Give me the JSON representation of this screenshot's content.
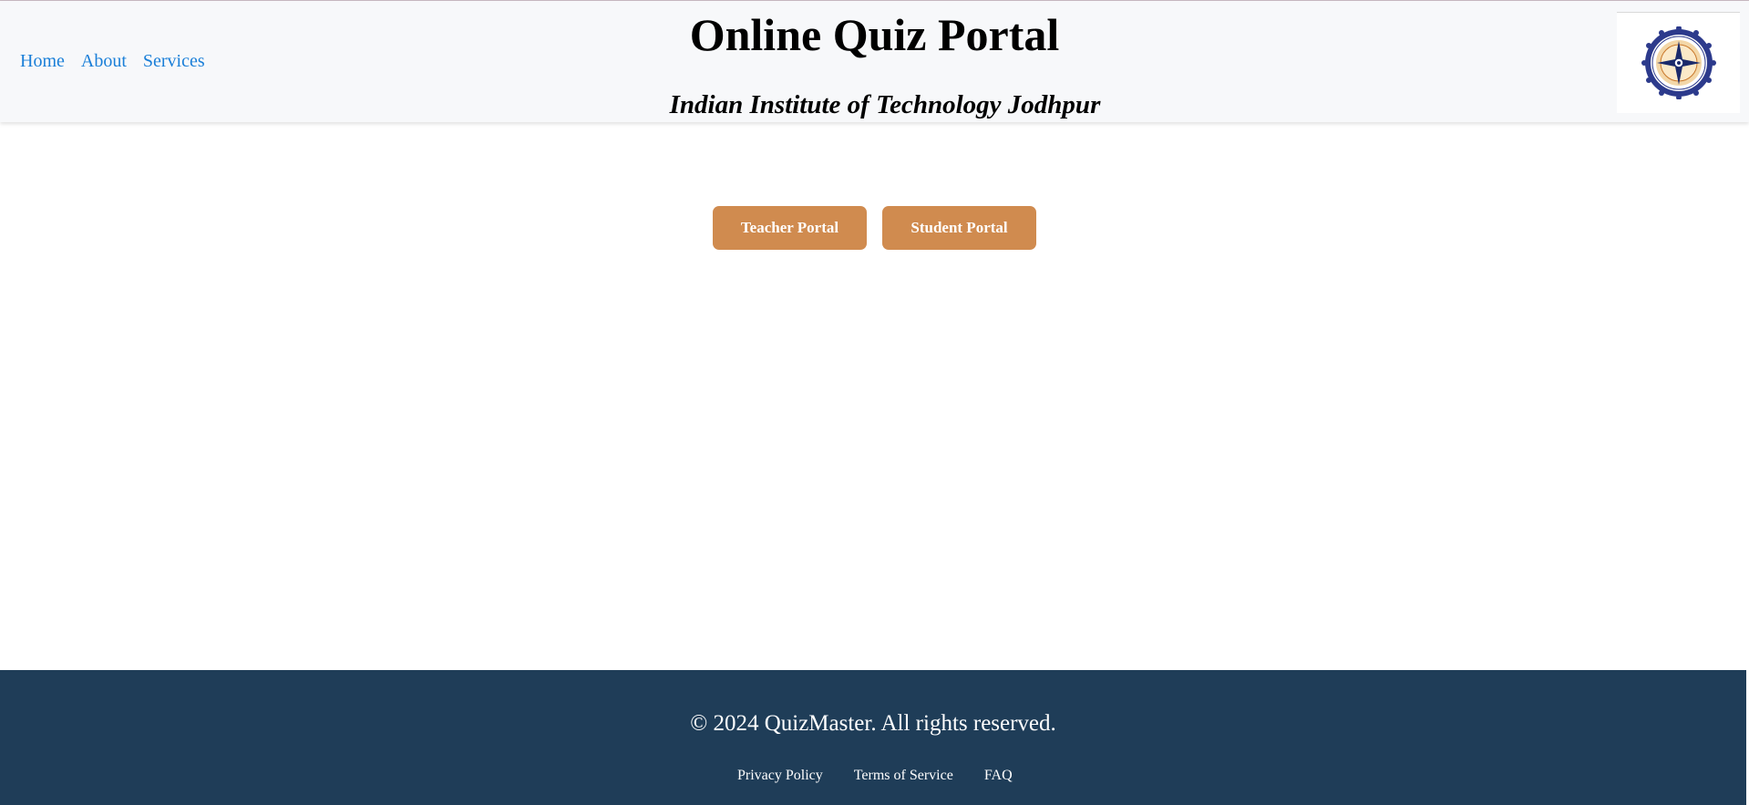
{
  "header": {
    "title": "Online Quiz Portal",
    "subtitle": "Indian Institute of Technology Jodhpur",
    "nav": [
      {
        "label": "Home"
      },
      {
        "label": "About"
      },
      {
        "label": "Services"
      }
    ],
    "logo_icon": "iit-jodhpur-logo"
  },
  "main": {
    "buttons": {
      "teacher": "Teacher Portal",
      "student": "Student Portal"
    }
  },
  "footer": {
    "copyright": "© 2024 QuizMaster. All rights reserved.",
    "links": [
      {
        "label": "Privacy Policy"
      },
      {
        "label": "Terms of Service"
      },
      {
        "label": "FAQ"
      }
    ]
  },
  "colors": {
    "header_bg": "#f7f8fa",
    "nav_link": "#1a7fd8",
    "button_bg": "#d08b4f",
    "footer_bg": "#1f3d58"
  }
}
